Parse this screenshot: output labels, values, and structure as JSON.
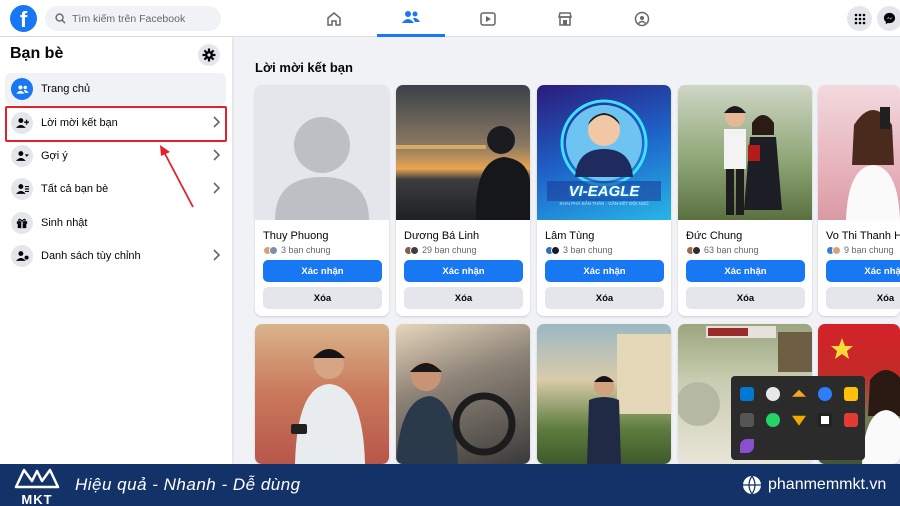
{
  "header": {
    "logo": "f",
    "search_placeholder": "Tìm kiếm trên Facebook",
    "nav_tabs": [
      "home-icon",
      "friends-icon",
      "watch-icon",
      "marketplace-icon",
      "groups-icon"
    ],
    "active_tab": "friends-icon",
    "right_buttons": [
      "menu-grid-icon",
      "messenger-icon"
    ],
    "accent_color": "#1877f2"
  },
  "sidebar": {
    "title": "Bạn bè",
    "items": [
      {
        "label": "Trang chủ",
        "icon": "friends-home-icon",
        "active": true,
        "chevron": false
      },
      {
        "label": "Lời mời kết bạn",
        "icon": "friend-request-icon",
        "active": false,
        "chevron": true
      },
      {
        "label": "Gợi ý",
        "icon": "friend-suggest-icon",
        "active": false,
        "chevron": true
      },
      {
        "label": "Tất cả bạn bè",
        "icon": "all-friends-icon",
        "active": false,
        "chevron": true
      },
      {
        "label": "Sinh nhật",
        "icon": "gift-icon",
        "active": false,
        "chevron": false
      },
      {
        "label": "Danh sách tùy chỉnh",
        "icon": "custom-list-icon",
        "active": false,
        "chevron": true
      }
    ],
    "highlight_color": "#e4212b"
  },
  "main": {
    "title": "Lời mời kết bạn",
    "confirm_label": "Xác nhận",
    "delete_label": "Xóa",
    "requests": [
      {
        "name": "Thuy Phuong",
        "mutual": "3 bạn chung"
      },
      {
        "name": "Dương Bá Linh",
        "mutual": "29 bạn chung"
      },
      {
        "name": "Lâm Tùng",
        "mutual": "3 bạn chung"
      },
      {
        "name": "Đức Chung",
        "mutual": "63 bạn chung"
      },
      {
        "name": "Vo Thi Thanh H",
        "mutual": "9 bạn chung"
      }
    ],
    "photo_badge": {
      "title": "VI-EAGLE",
      "subtitle": "KHAI PHÁ BẢN THÂN · GẮN KẾT ĐỘI NGŨ"
    }
  },
  "system_tray": {
    "icons": [
      "skype-icon",
      "chrome-icon",
      "cloud-icon",
      "check-icon",
      "flag-icon",
      "mute-icon",
      "whatsapp-icon",
      "arrow-icon",
      "record-icon",
      "app-icon",
      "feather-icon"
    ]
  },
  "footer": {
    "brand": "MKT",
    "slogan": "Hiệu quả - Nhanh - Dễ dùng",
    "website": "phanmemmkt.vn",
    "background": "#123268"
  }
}
